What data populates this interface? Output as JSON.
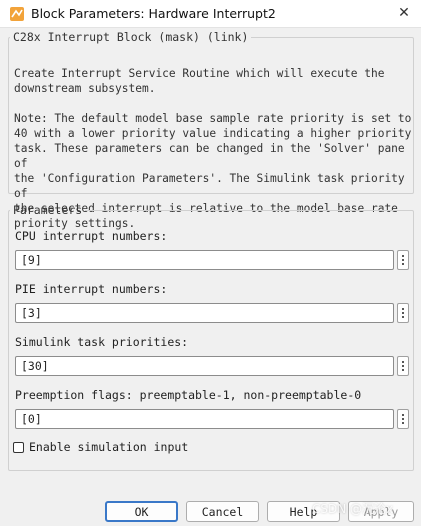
{
  "window": {
    "title": "Block Parameters: Hardware Interrupt2",
    "close_glyph": "✕"
  },
  "description": {
    "legend": "C28x Interrupt Block (mask) (link)",
    "text": "Create Interrupt Service Routine which will execute the\ndownstream subsystem.\n\nNote: The default model base sample rate priority is set to\n40 with a lower priority value indicating a higher priority\ntask. These parameters can be changed in the 'Solver' pane of\nthe 'Configuration Parameters'. The Simulink task priority of\nthe selected interrupt is relative to the model base rate\npriority settings."
  },
  "parameters": {
    "legend": "Parameters",
    "fields": [
      {
        "label": "CPU interrupt numbers:",
        "value": "[9]"
      },
      {
        "label": "PIE interrupt numbers:",
        "value": "[3]"
      },
      {
        "label": "Simulink task priorities:",
        "value": "[30]"
      },
      {
        "label": "Preemption flags: preemptable-1, non-preemptable-0",
        "value": "[0]"
      }
    ],
    "checkbox_label": "Enable simulation input",
    "checkbox_checked": false
  },
  "buttons": {
    "ok": "OK",
    "cancel": "Cancel",
    "help": "Help",
    "apply": "Apply"
  },
  "watermark": "CSDN @沉沦x",
  "colors": {
    "window_bg": "#f0f0f0",
    "ok_border": "#3a78c8"
  }
}
